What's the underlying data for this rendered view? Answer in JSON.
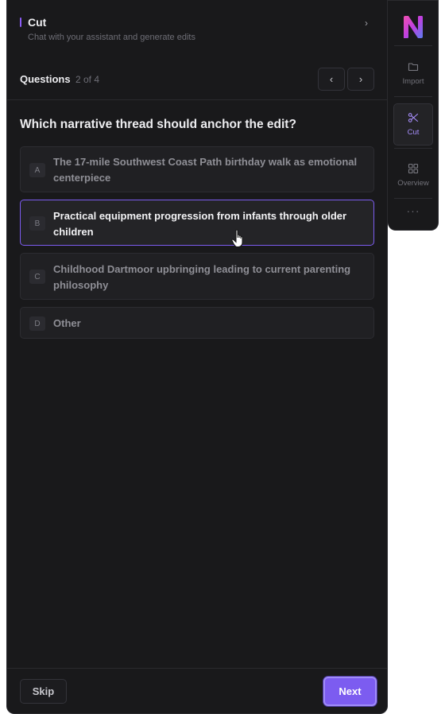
{
  "header": {
    "title": "Cut",
    "subtitle": "Chat with your assistant and generate edits",
    "collapse_glyph": "›"
  },
  "questions": {
    "label": "Questions",
    "count": "2 of 4",
    "prev_glyph": "‹",
    "next_glyph": "›"
  },
  "question": {
    "text": "Which narrative thread should anchor the edit?",
    "options": [
      {
        "letter": "A",
        "text": "The 17-mile Southwest Coast Path birthday walk as emotional centerpiece",
        "selected": false
      },
      {
        "letter": "B",
        "text": "Practical equipment progression from infants through older children",
        "selected": true
      },
      {
        "letter": "C",
        "text": "Childhood Dartmoor upbringing leading to current parenting philosophy",
        "selected": false
      },
      {
        "letter": "D",
        "text": "Other",
        "selected": false
      }
    ]
  },
  "footer": {
    "skip_label": "Skip",
    "next_label": "Next"
  },
  "rail": {
    "logo_icon": "app-logo",
    "items": [
      {
        "label": "Import",
        "icon": "folder-icon",
        "active": false
      },
      {
        "label": "Cut",
        "icon": "scissors-icon",
        "active": true
      },
      {
        "label": "Overview",
        "icon": "grid-icon",
        "active": false
      }
    ],
    "more_glyph": "···"
  },
  "colors": {
    "accent": "#7c5cf0",
    "panel_bg": "#19191b"
  }
}
